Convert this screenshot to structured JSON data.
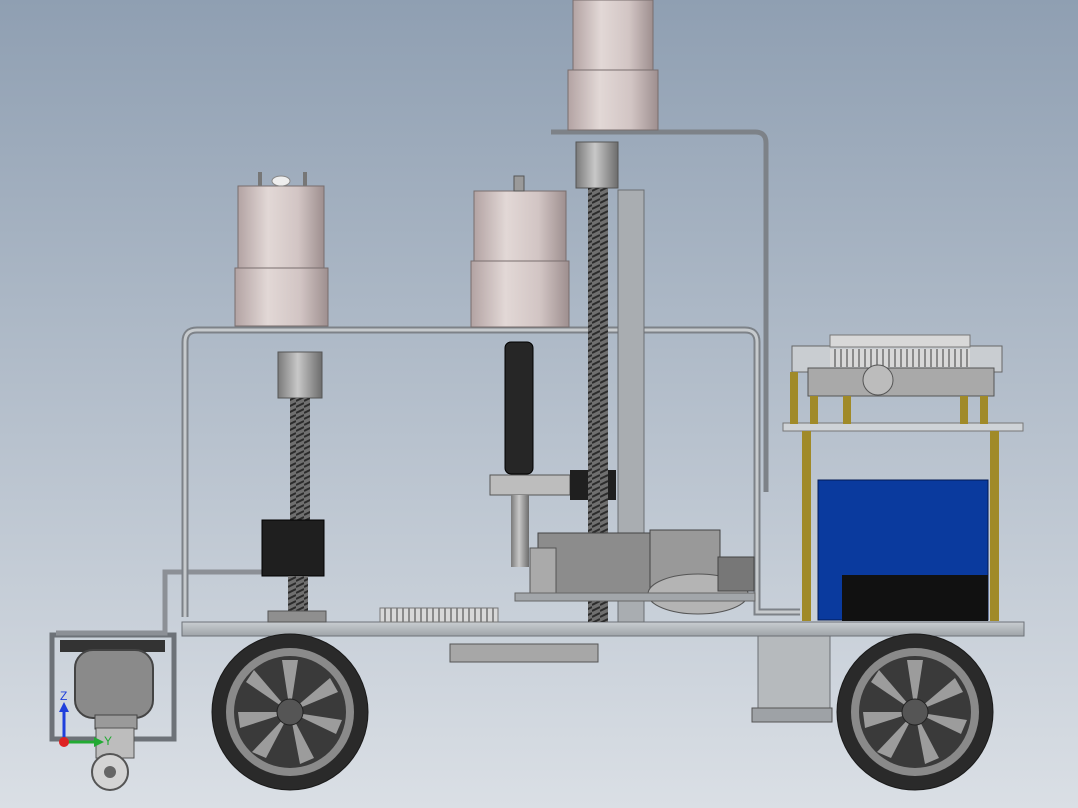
{
  "viewport": {
    "background_top": "#8f9fb2",
    "background_bottom": "#dadfe5"
  },
  "triad": {
    "z_label": "Z",
    "y_label": "Y",
    "z_color": "#1f3fdc",
    "y_color": "#22aa33",
    "x_color": "#dd2222"
  },
  "colors": {
    "motor_body": "#d6cbcb",
    "frame_steel": "#b0b4b8",
    "dark_block": "#1e1e1e",
    "battery_blue": "#0a3a9e",
    "brass_post": "#a08a28",
    "tire": "#2a2a2a",
    "rim": "#8a8a8a"
  }
}
